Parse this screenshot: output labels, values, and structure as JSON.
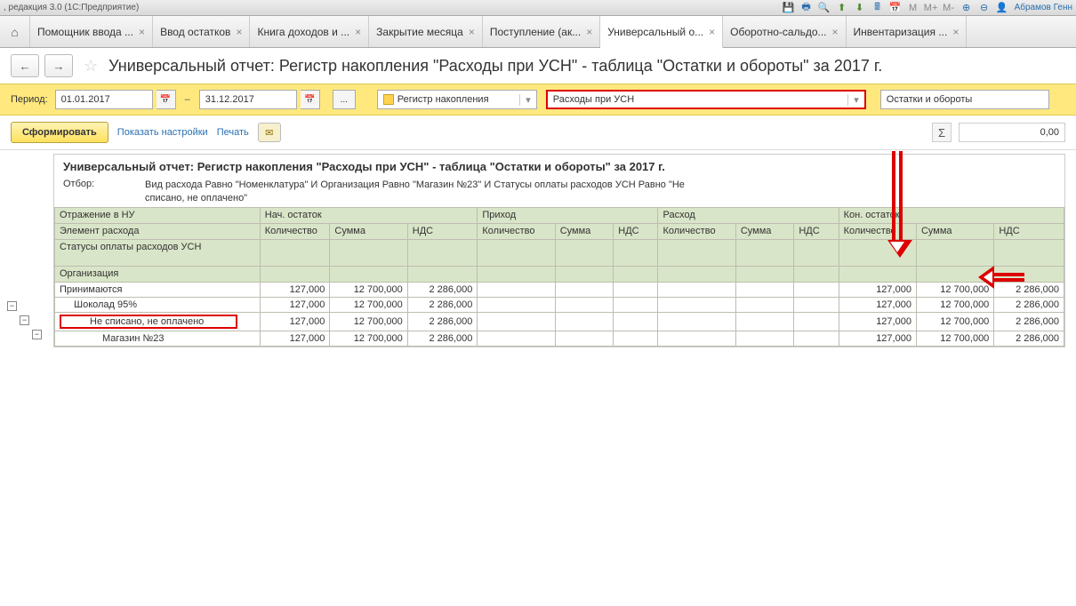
{
  "app": {
    "title": ", редакция 3.0  (1С:Предприятие)",
    "user": "Абрамов Генн"
  },
  "tabs": [
    "Помощник ввода ...",
    "Ввод остатков",
    "Книга доходов и ...",
    "Закрытие месяца",
    "Поступление (ак...",
    "Универсальный о...",
    "Оборотно-сальдо...",
    "Инвентаризация ..."
  ],
  "active_tab": 5,
  "page_title": "Универсальный отчет: Регистр накопления \"Расходы при УСН\" - таблица \"Остатки и обороты\" за 2017 г.",
  "filter": {
    "period_label": "Период:",
    "from": "01.01.2017",
    "to": "31.12.2017",
    "register_type": "Регистр накопления",
    "register": "Расходы при УСН",
    "table": "Остатки и обороты"
  },
  "buttons": {
    "generate": "Сформировать",
    "settings": "Показать настройки",
    "print": "Печать"
  },
  "sum": "0,00",
  "report": {
    "title": "Универсальный отчет: Регистр накопления \"Расходы при УСН\" - таблица \"Остатки и обороты\" за 2017 г.",
    "filter_label": "Отбор:",
    "filter_text": "Вид расхода Равно \"Номенклатура\" И Организация Равно \"Магазин №23\" И Статусы оплаты расходов УСН Равно \"Не списано, не оплачено\"",
    "head": {
      "dim": "Отражение в НУ",
      "beg": "Нач. остаток",
      "inc": "Приход",
      "exp": "Расход",
      "end": "Кон. остаток",
      "el": "Элемент расхода",
      "status": "Статусы оплаты расходов УСН",
      "org": "Организация",
      "qty": "Количество",
      "sum": "Сумма",
      "vat": "НДС"
    },
    "rows": [
      {
        "label": "Принимаются",
        "indent": 0,
        "beg_q": "127,000",
        "beg_s": "12 700,000",
        "beg_v": "2 286,000",
        "end_q": "127,000",
        "end_s": "12 700,000",
        "end_v": "2 286,000"
      },
      {
        "label": "Шоколад 95%",
        "indent": 1,
        "beg_q": "127,000",
        "beg_s": "12 700,000",
        "beg_v": "2 286,000",
        "end_q": "127,000",
        "end_s": "12 700,000",
        "end_v": "2 286,000"
      },
      {
        "label": "Не списано, не оплачено",
        "indent": 2,
        "hilite": true,
        "beg_q": "127,000",
        "beg_s": "12 700,000",
        "beg_v": "2 286,000",
        "end_q": "127,000",
        "end_s": "12 700,000",
        "end_v": "2 286,000"
      },
      {
        "label": "Магазин №23",
        "indent": 3,
        "beg_q": "127,000",
        "beg_s": "12 700,000",
        "beg_v": "2 286,000",
        "end_q": "127,000",
        "end_s": "12 700,000",
        "end_v": "2 286,000"
      }
    ]
  }
}
